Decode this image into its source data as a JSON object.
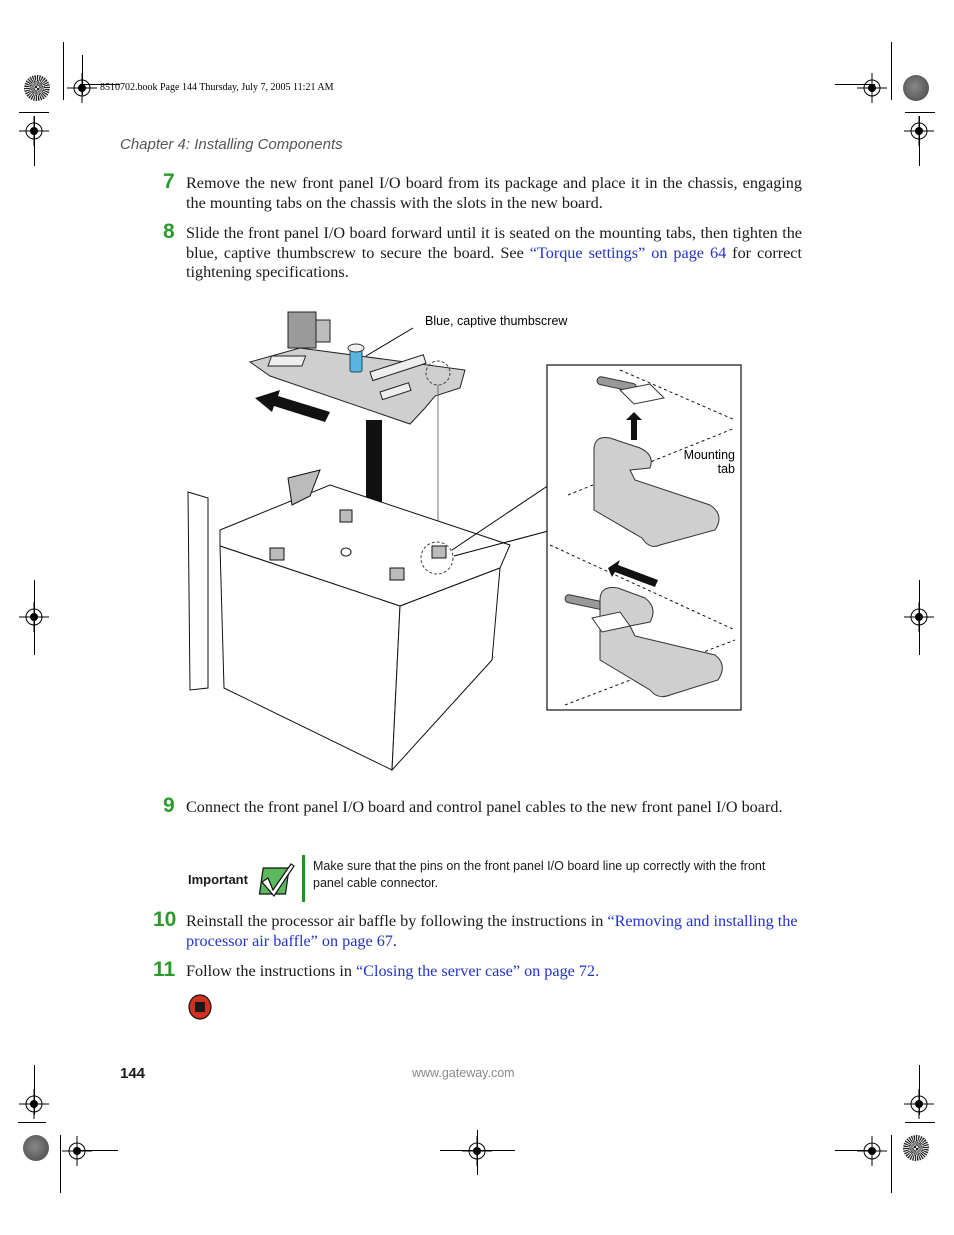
{
  "print_header": "8510702.book  Page 144  Thursday, July 7, 2005  11:21 AM",
  "running_head": "Chapter 4: Installing Components",
  "steps": [
    {
      "number": "7",
      "text_before": "Remove the new front panel I/O board from its package and place it in the chassis, engaging the mounting tabs on the chassis with the slots in the new board.",
      "link": "",
      "text_after": ""
    },
    {
      "number": "8",
      "text_before": "Slide the front panel I/O board forward until it is seated on the mounting tabs, then tighten the blue, captive thumbscrew to secure the board. See ",
      "link": "“Torque settings” on page 64",
      "text_after": " for correct tightening specifications."
    },
    {
      "number": "9",
      "text_before": "Connect the front panel I/O board and control panel cables to the new front panel I/O board.",
      "link": "",
      "text_after": ""
    },
    {
      "number": "10",
      "text_before": "Reinstall the processor air baffle by following the instructions in ",
      "link": "“Removing and installing the processor air baffle” on page 67",
      "text_after": "."
    },
    {
      "number": "11",
      "text_before": "Follow the instructions in ",
      "link": "“Closing the server case” on page 72.",
      "text_after": ""
    }
  ],
  "figure": {
    "callout_thumbscrew": "Blue, captive thumbscrew",
    "callout_mounting_tab_line1": "Mounting",
    "callout_mounting_tab_line2": "tab"
  },
  "important": {
    "label": "Important",
    "text": "Make sure that the pins on the front panel I/O board line up correctly with the front panel cable connector."
  },
  "footer": {
    "page_number": "144",
    "website": "www.gateway.com"
  },
  "colors": {
    "step_number": "#2a9a2a",
    "link": "#2233cc",
    "important_bar": "#1a9a1a",
    "thumbscrew": "#5ab4e0",
    "stop_icon": "#d03020"
  }
}
